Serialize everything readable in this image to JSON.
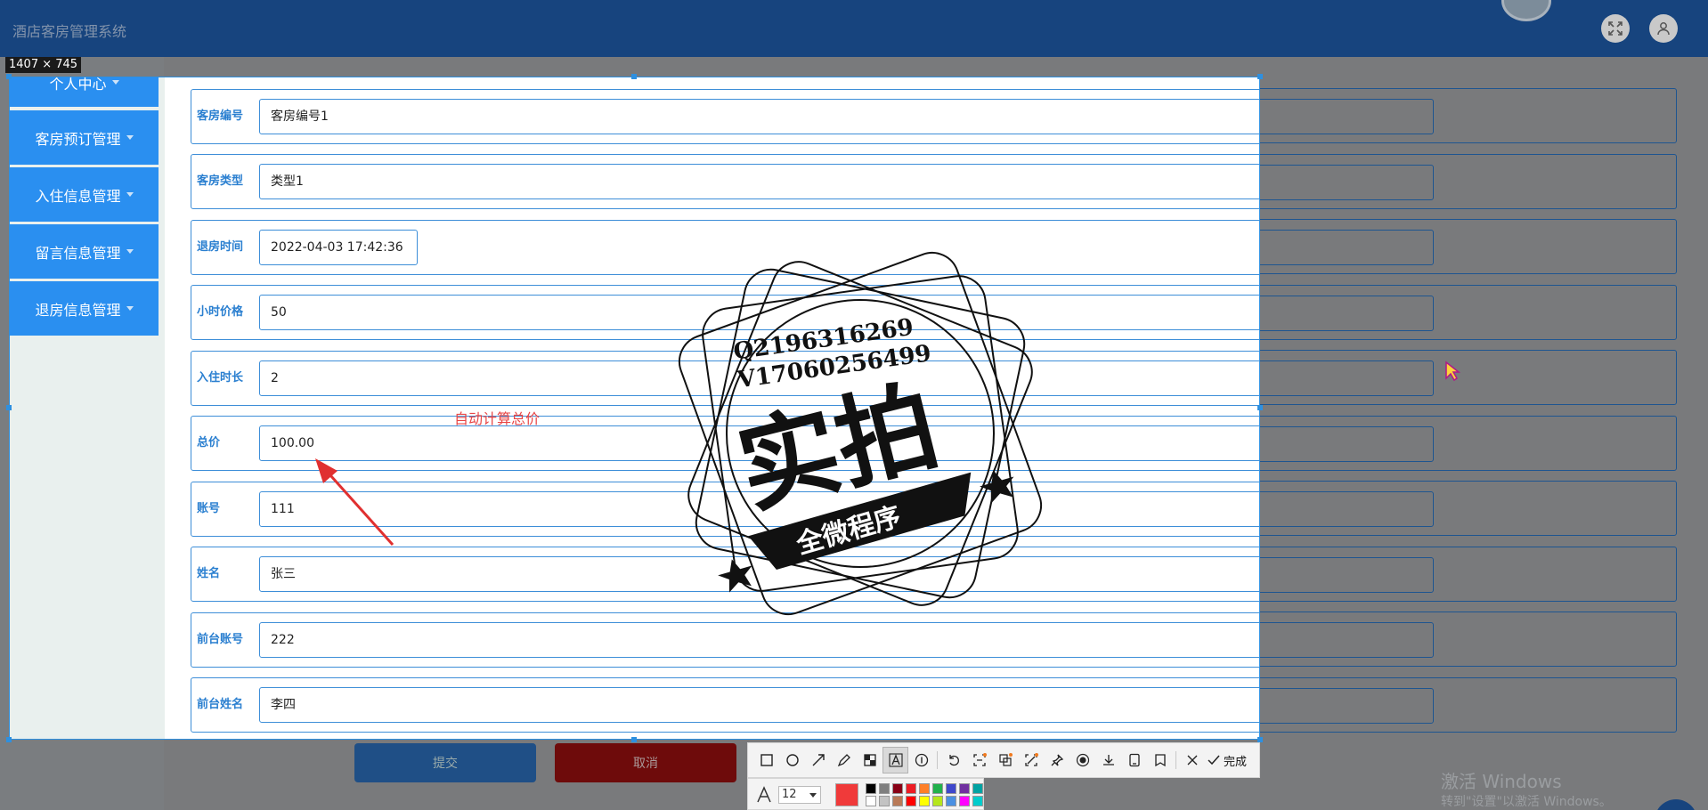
{
  "app": {
    "title": "酒店客房管理系统"
  },
  "header_icons": [
    "fullscreen-icon",
    "user-icon"
  ],
  "capture": {
    "size_label": "1407 × 745",
    "selection_color": "#2e90e0"
  },
  "sidebar": {
    "items": [
      {
        "label": "个人中心"
      },
      {
        "label": "客房预订管理"
      },
      {
        "label": "入住信息管理"
      },
      {
        "label": "留言信息管理"
      },
      {
        "label": "退房信息管理"
      }
    ],
    "color": "#2a8ff0"
  },
  "form": {
    "fields": [
      {
        "label": "客房编号",
        "value": "客房编号1"
      },
      {
        "label": "客房类型",
        "value": "类型1"
      },
      {
        "label": "退房时间",
        "value": "2022-04-03 17:42:36"
      },
      {
        "label": "小时价格",
        "value": "50"
      },
      {
        "label": "入住时长",
        "value": "2"
      },
      {
        "label": "总价",
        "value": "100.00"
      },
      {
        "label": "账号",
        "value": "111"
      },
      {
        "label": "姓名",
        "value": "张三"
      },
      {
        "label": "前台账号",
        "value": "222"
      },
      {
        "label": "前台姓名",
        "value": "李四"
      }
    ],
    "submit_label": "提交",
    "cancel_label": "取消"
  },
  "annotation": {
    "text": "自动计算总价",
    "color": "#e84545"
  },
  "stamp": {
    "line1": "Q2196316269",
    "line2": "V17060256499",
    "main": "实拍",
    "banner": "全微程序"
  },
  "toolbar": {
    "tools": [
      "rectangle-icon",
      "ellipse-icon",
      "arrow-icon",
      "pencil-icon",
      "mosaic-icon",
      "text-icon",
      "number-icon",
      "undo-icon",
      "ocr-icon",
      "translate-icon",
      "scan-icon",
      "pin-icon",
      "record-icon",
      "download-icon",
      "save-device-icon",
      "bookmark-icon",
      "close-icon"
    ],
    "done_label": "完成",
    "font_size": "12",
    "current_color": "#f03a3a",
    "palette": [
      "#000000",
      "#7f7f7f",
      "#880015",
      "#ed1c24",
      "#ff7f27",
      "#22b14c",
      "#3f48cc",
      "#7030a0",
      "#00a2a2",
      "#ffffff",
      "#c3c3c3",
      "#b97a57",
      "#ff0000",
      "#ffff00",
      "#b5e61d",
      "#4a90e2",
      "#ff00ff",
      "#00cccc"
    ]
  },
  "windows_watermark": {
    "line1": "激活 Windows",
    "line2": "转到\"设置\"以激活 Windows。"
  }
}
